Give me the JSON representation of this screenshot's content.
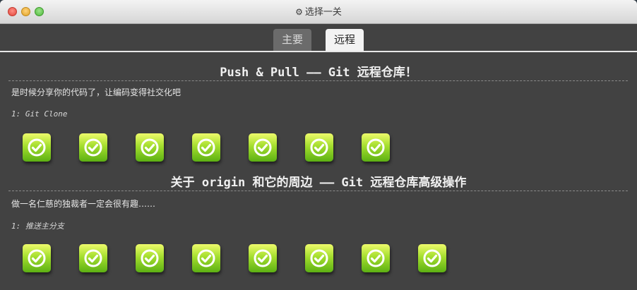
{
  "window": {
    "title": "选择一关",
    "title_icon": "gear-icon"
  },
  "tabs": [
    {
      "label": "主要",
      "active": false
    },
    {
      "label": "远程",
      "active": true
    }
  ],
  "sections": [
    {
      "title": "Push & Pull —— Git 远程仓库！",
      "description": "是时候分享你的代码了，让编码变得社交化吧",
      "subtitle": "1: Git Clone",
      "level_count": 7,
      "level_state": "completed"
    },
    {
      "title": "关于 origin 和它的周边 —— Git 远程仓库高级操作",
      "description": "做一名仁慈的独裁者一定会很有趣……",
      "subtitle": "1: 推送主分支",
      "level_count": 8,
      "level_state": "completed"
    }
  ],
  "colors": {
    "background": "#424242",
    "level_green_top": "#eefb6b",
    "level_green_bottom": "#5cb013",
    "active_tab": "#f3f3f3",
    "inactive_tab": "#6b6b6b"
  }
}
